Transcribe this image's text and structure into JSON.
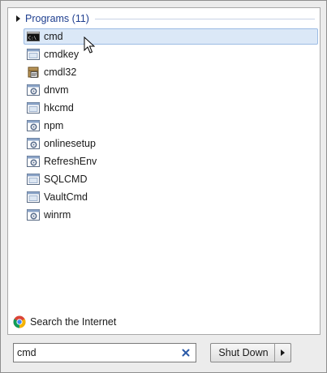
{
  "programs": {
    "header": "Programs (11)",
    "items": [
      {
        "label": "cmd",
        "icon": "console-icon",
        "selected": true
      },
      {
        "label": "cmdkey",
        "icon": "app-window-icon"
      },
      {
        "label": "cmdl32",
        "icon": "setup-package-icon"
      },
      {
        "label": "dnvm",
        "icon": "settings-window-icon"
      },
      {
        "label": "hkcmd",
        "icon": "app-window-icon"
      },
      {
        "label": "npm",
        "icon": "settings-window-icon"
      },
      {
        "label": "onlinesetup",
        "icon": "settings-window-icon"
      },
      {
        "label": "RefreshEnv",
        "icon": "settings-window-icon"
      },
      {
        "label": "SQLCMD",
        "icon": "app-window-icon"
      },
      {
        "label": "VaultCmd",
        "icon": "app-window-icon"
      },
      {
        "label": "winrm",
        "icon": "settings-window-icon"
      }
    ]
  },
  "search_internet": {
    "label": "Search the Internet",
    "icon": "chrome-icon"
  },
  "search": {
    "value": "cmd",
    "clear_icon": "clear-x-icon"
  },
  "shutdown": {
    "label": "Shut Down",
    "arrow_icon": "arrow-right-icon"
  },
  "colors": {
    "accent": "#1e3e8f",
    "selection": "#dbe8f7",
    "selection_border": "#9cbbe3"
  }
}
